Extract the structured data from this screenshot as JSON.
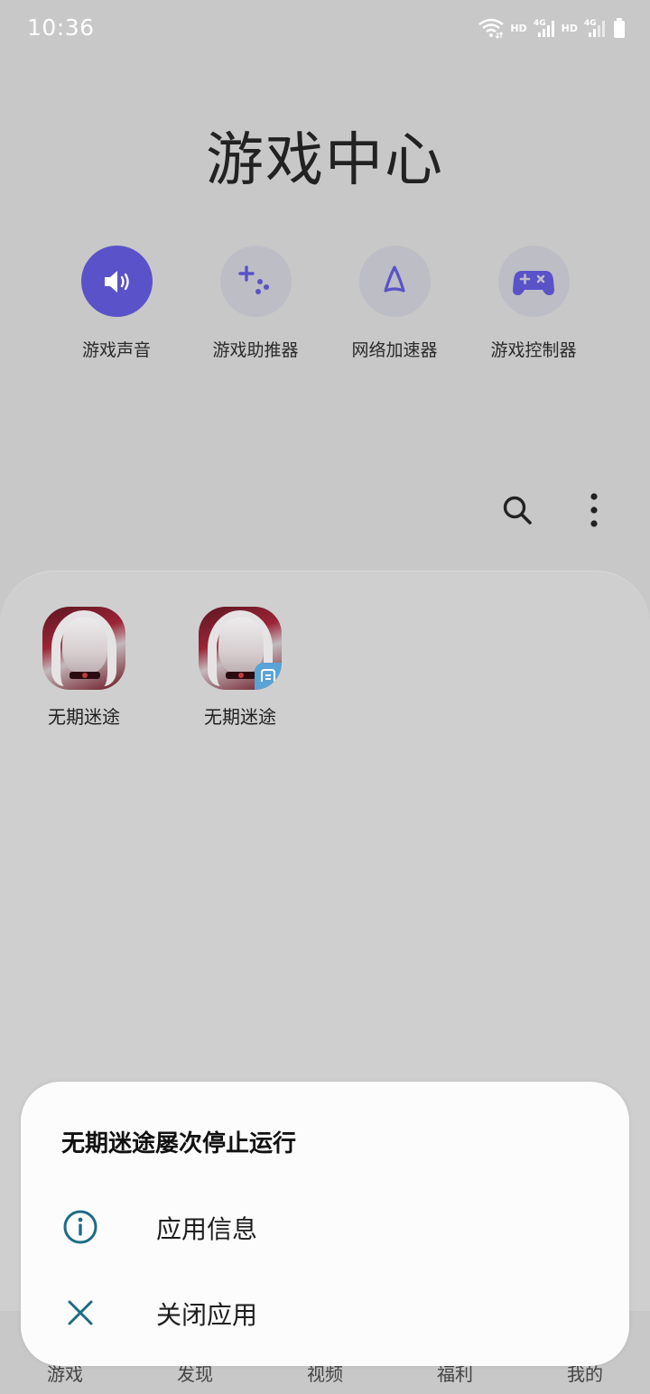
{
  "status_bar": {
    "time": "10:36",
    "hd_1": "HD",
    "hd_2": "HD",
    "net_1": "4G",
    "net_2": "4G"
  },
  "app": {
    "title": "游戏中心",
    "accent_color": "#5a52c9"
  },
  "shortcuts": [
    {
      "label": "游戏声音",
      "icon": "speaker-icon",
      "active": true
    },
    {
      "label": "游戏助推器",
      "icon": "booster-icon",
      "active": false
    },
    {
      "label": "网络加速器",
      "icon": "rocket-icon",
      "active": false
    },
    {
      "label": "游戏控制器",
      "icon": "gamepad-icon",
      "active": false
    }
  ],
  "toolbar": {
    "search_icon": "search-icon",
    "more_icon": "more-vertical-icon"
  },
  "games": [
    {
      "label": "无期迷途",
      "icon": "game-app-icon",
      "badge": false
    },
    {
      "label": "无期迷途",
      "icon": "game-app-icon",
      "badge": true
    }
  ],
  "bottom_nav": [
    {
      "label": "游戏"
    },
    {
      "label": "发现"
    },
    {
      "label": "视频"
    },
    {
      "label": "福利"
    },
    {
      "label": "我的"
    }
  ],
  "dialog": {
    "title": "无期迷途屡次停止运行",
    "options": [
      {
        "label": "应用信息",
        "icon": "info-icon"
      },
      {
        "label": "关闭应用",
        "icon": "close-icon"
      }
    ],
    "icon_color": "#1e6b86"
  }
}
